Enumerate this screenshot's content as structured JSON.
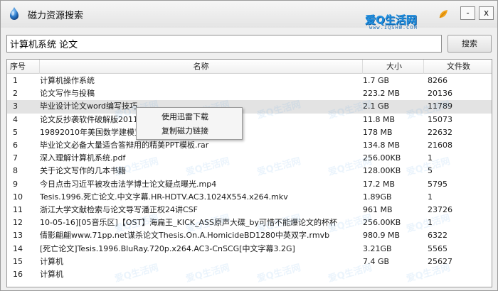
{
  "window": {
    "title": "磁力资源搜索",
    "min_label": "-",
    "close_label": "x"
  },
  "brand": {
    "logo": "爱Q生活网",
    "url": "www.IQSHW.COM",
    "color": "#1f8fe0"
  },
  "search": {
    "value": "计算机系统 论文",
    "button_label": "搜索"
  },
  "table": {
    "columns": [
      "序号",
      "名称",
      "大小",
      "文件数"
    ],
    "selected_index": 2,
    "rows": [
      {
        "idx": "1",
        "name": "计算机操作系统",
        "size": "1.7 GB",
        "count": "8266"
      },
      {
        "idx": "2",
        "name": "论文写作与投稿",
        "size": "223.2 MB",
        "count": "20136"
      },
      {
        "idx": "3",
        "name": "毕业设计论文word编写技巧",
        "size": "2.1 GB",
        "count": "11789"
      },
      {
        "idx": "4",
        "name": "论文反抄袭软件破解版2011",
        "size": "11.8 MB",
        "count": "15073"
      },
      {
        "idx": "5",
        "name": "19892010年美国数学建模竞",
        "size": "178 MB",
        "count": "22632"
      },
      {
        "idx": "6",
        "name": "毕业论文必备大量适合答辩用的精美PPT模板.rar",
        "size": "134.8 MB",
        "count": "21608"
      },
      {
        "idx": "7",
        "name": "深入理解计算机系统.pdf",
        "size": "256.00KB",
        "count": "1"
      },
      {
        "idx": "8",
        "name": "关于论文写作的几本书籍",
        "size": "128.00KB",
        "count": "5"
      },
      {
        "idx": "9",
        "name": "今日点击习近平被攻击法学博士论文疑点曝光.mp4",
        "size": "17.2 MB",
        "count": "5795"
      },
      {
        "idx": "10",
        "name": "Tesis.1996.死亡论文.中文字幕.HR-HDTV.AC3.1024X554.x264.mkv",
        "size": "1.89GB",
        "count": "1"
      },
      {
        "idx": "11",
        "name": "浙江大学文献检索与论文导写潘正权24讲CSF",
        "size": "961 MB",
        "count": "23726"
      },
      {
        "idx": "12",
        "name": "10-05-16][05音乐区]【OST】海扁王_KICK_ASS原声大碟_by可惜不能爆论文的杯杯",
        "size": "256.00KB",
        "count": "1"
      },
      {
        "idx": "13",
        "name": "倩影翩翩www.71pp.net谋杀论文Thesis.On.A.HomicideBD1280中英双字.rmvb",
        "size": "980.9 MB",
        "count": "6322"
      },
      {
        "idx": "14",
        "name": "[死亡论文]Tesis.1996.BluRay.720p.x264.AC3-CnSCG[中文字幕3.2G]",
        "size": "3.21GB",
        "count": "5565"
      },
      {
        "idx": "15",
        "name": "计算机",
        "size": "7.4 GB",
        "count": "25627"
      },
      {
        "idx": "16",
        "name": "计算机",
        "size": "",
        "count": ""
      }
    ]
  },
  "context_menu": {
    "items": [
      "使用迅雷下载",
      "复制磁力链接"
    ]
  },
  "watermark": "爱Q生活网"
}
